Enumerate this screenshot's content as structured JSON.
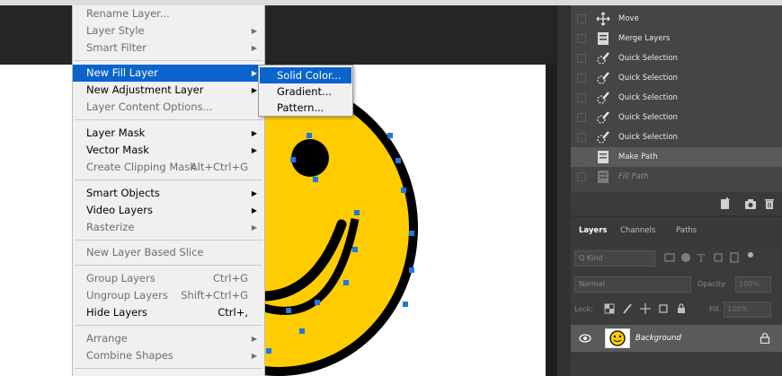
{
  "context_menu": {
    "items": [
      {
        "label": "Rename Layer...",
        "enabled": false
      },
      {
        "label": "Layer Style",
        "enabled": false,
        "submenu": true
      },
      {
        "label": "Smart Filter",
        "enabled": false,
        "submenu": true
      },
      {
        "label": "New Fill Layer",
        "enabled": true,
        "submenu": true,
        "highlighted": true
      },
      {
        "label": "New Adjustment Layer",
        "enabled": true,
        "submenu": true
      },
      {
        "label": "Layer Content Options...",
        "enabled": false
      },
      {
        "label": "Layer Mask",
        "enabled": true,
        "submenu": true
      },
      {
        "label": "Vector Mask",
        "enabled": true,
        "submenu": true
      },
      {
        "label": "Create Clipping Mask",
        "shortcut": "Alt+Ctrl+G",
        "enabled": false
      },
      {
        "label": "Smart Objects",
        "enabled": true,
        "submenu": true
      },
      {
        "label": "Video Layers",
        "enabled": true,
        "submenu": true
      },
      {
        "label": "Rasterize",
        "enabled": false,
        "submenu": true
      },
      {
        "label": "New Layer Based Slice",
        "enabled": false
      },
      {
        "label": "Group Layers",
        "shortcut": "Ctrl+G",
        "enabled": false
      },
      {
        "label": "Ungroup Layers",
        "shortcut": "Shift+Ctrl+G",
        "enabled": false
      },
      {
        "label": "Hide Layers",
        "shortcut": "Ctrl+,",
        "enabled": true
      },
      {
        "label": "Arrange",
        "enabled": false,
        "submenu": true
      },
      {
        "label": "Combine Shapes",
        "enabled": false,
        "submenu": true
      }
    ]
  },
  "fill_submenu": {
    "items": [
      {
        "label": "Solid Color...",
        "highlighted": true
      },
      {
        "label": "Gradient..."
      },
      {
        "label": "Pattern..."
      }
    ]
  },
  "history": {
    "items": [
      {
        "label": "Move",
        "icon": "move-icon"
      },
      {
        "label": "Merge Layers",
        "icon": "document-icon"
      },
      {
        "label": "Quick Selection",
        "icon": "quick-selection-icon"
      },
      {
        "label": "Quick Selection",
        "icon": "quick-selection-icon"
      },
      {
        "label": "Quick Selection",
        "icon": "quick-selection-icon"
      },
      {
        "label": "Quick Selection",
        "icon": "quick-selection-icon"
      },
      {
        "label": "Quick Selection",
        "icon": "quick-selection-icon"
      },
      {
        "label": "Make Path",
        "icon": "document-icon",
        "selected": true
      },
      {
        "label": "Fill Path",
        "icon": "document-icon",
        "dimmed": true
      }
    ]
  },
  "layers_panel": {
    "tabs": [
      "Layers",
      "Channels",
      "Paths"
    ],
    "kind_label": "Q Kind",
    "blend_mode": "Normal",
    "opacity_label": "Opacity:",
    "opacity_value": "100%",
    "lock_label": "Lock:",
    "fill_label": "Fill:",
    "fill_value": "100%",
    "layer": {
      "name": "Background"
    }
  },
  "colors": {
    "menu_highlight": "#0a64cc",
    "smiley_fill": "#ffcc00",
    "anchor_point": "#1e78e0"
  }
}
